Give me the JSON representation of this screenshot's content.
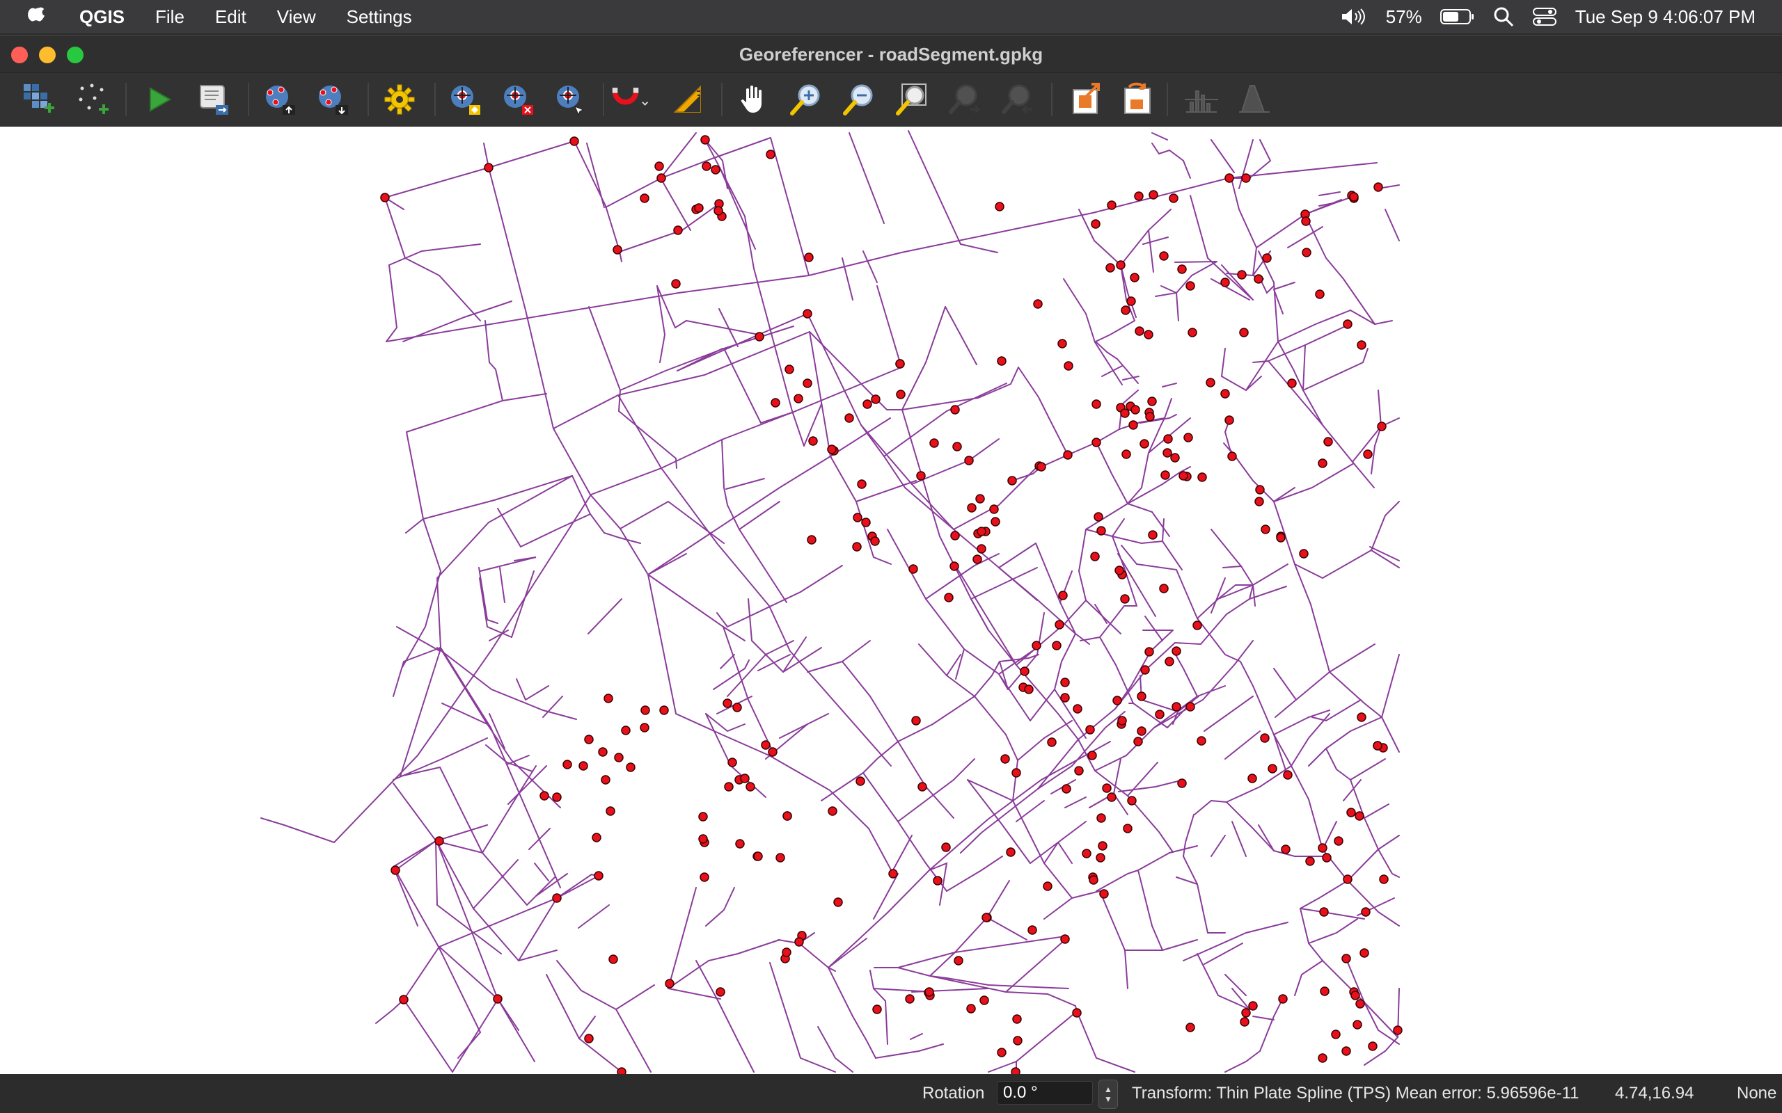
{
  "menubar": {
    "app_name": "QGIS",
    "items": [
      "File",
      "Edit",
      "View",
      "Settings"
    ],
    "battery_percent": "57%",
    "datetime": "Tue Sep 9  4:06:07 PM"
  },
  "window": {
    "title": "Georeferencer - roadSegment.gpkg"
  },
  "toolbar": {
    "buttons": [
      "open-raster-icon",
      "add-point-icon",
      "start-georeferencing-icon",
      "generate-gdal-script-icon",
      "load-gcp-points-icon",
      "save-gcp-points-icon",
      "transformation-settings-icon",
      "add-gcp-point-icon",
      "delete-gcp-point-icon",
      "move-gcp-point-icon",
      "snapping-icon",
      "measure-icon",
      "pan-icon",
      "zoom-in-icon",
      "zoom-out-icon",
      "zoom-to-layer-icon",
      "zoom-last-icon",
      "zoom-next-icon",
      "link-georeferencer-icon",
      "link-qgis-icon",
      "histogram-stretch-icon",
      "local-histogram-icon"
    ]
  },
  "map": {
    "line_color": "#8a3c9a",
    "point_fill": "#e8101b",
    "point_stroke": "#3a0000"
  },
  "statusbar": {
    "rotation_label": "Rotation",
    "rotation_value": "0.0 °",
    "transform_text": "Transform: Thin Plate Spline (TPS) Mean error: 5.96596e-11",
    "coordinates": "4.74,16.94",
    "crs": "None"
  }
}
